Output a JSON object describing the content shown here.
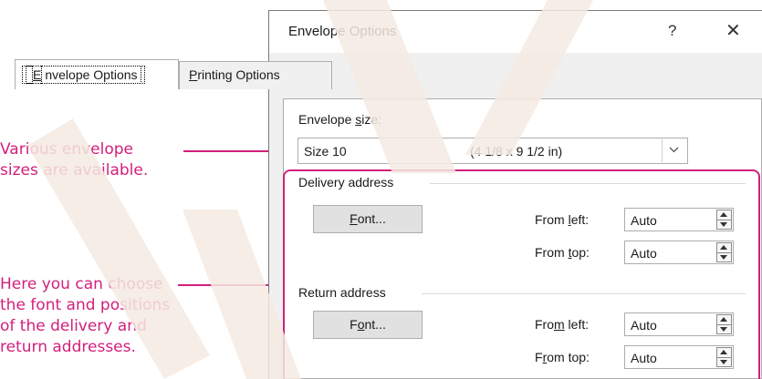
{
  "callouts": {
    "sizes": [
      "Various envelope",
      "sizes are available."
    ],
    "font_positions": [
      "Here you can choose",
      "the font and positions",
      "of the delivery and",
      "return addresses."
    ]
  },
  "dialog": {
    "title": "Envelope Options",
    "help": "?",
    "close": "✕",
    "tabs": {
      "envelope": {
        "pre": "",
        "key": "E",
        "post": "nvelope Options"
      },
      "printing": {
        "pre": "",
        "key": "P",
        "post": "rinting Options"
      }
    },
    "envelope_size": {
      "label_pre": "Envelope ",
      "label_key": "s",
      "label_post": "ize:",
      "value_name": "Size 10",
      "value_dims": "(4 1/8 x 9 1/2 in)"
    },
    "delivery": {
      "heading": "Delivery address",
      "font_button": {
        "pre": "",
        "key": "F",
        "post": "ont..."
      },
      "from_left": {
        "pre": "From ",
        "key": "l",
        "post": "eft:",
        "value": "Auto"
      },
      "from_top": {
        "pre": "From ",
        "key": "t",
        "post": "op:",
        "value": "Auto"
      }
    },
    "return": {
      "heading": "Return address",
      "font_button": {
        "pre": "F",
        "key": "o",
        "post": "nt..."
      },
      "from_left": {
        "pre": "Fro",
        "key": "m",
        "post": " left:",
        "value": "Auto"
      },
      "from_top": {
        "pre": "F",
        "key": "r",
        "post": "om top:",
        "value": "Auto"
      }
    }
  },
  "colors": {
    "accent": "#d21f7c",
    "watermark": "#f5eae2"
  }
}
